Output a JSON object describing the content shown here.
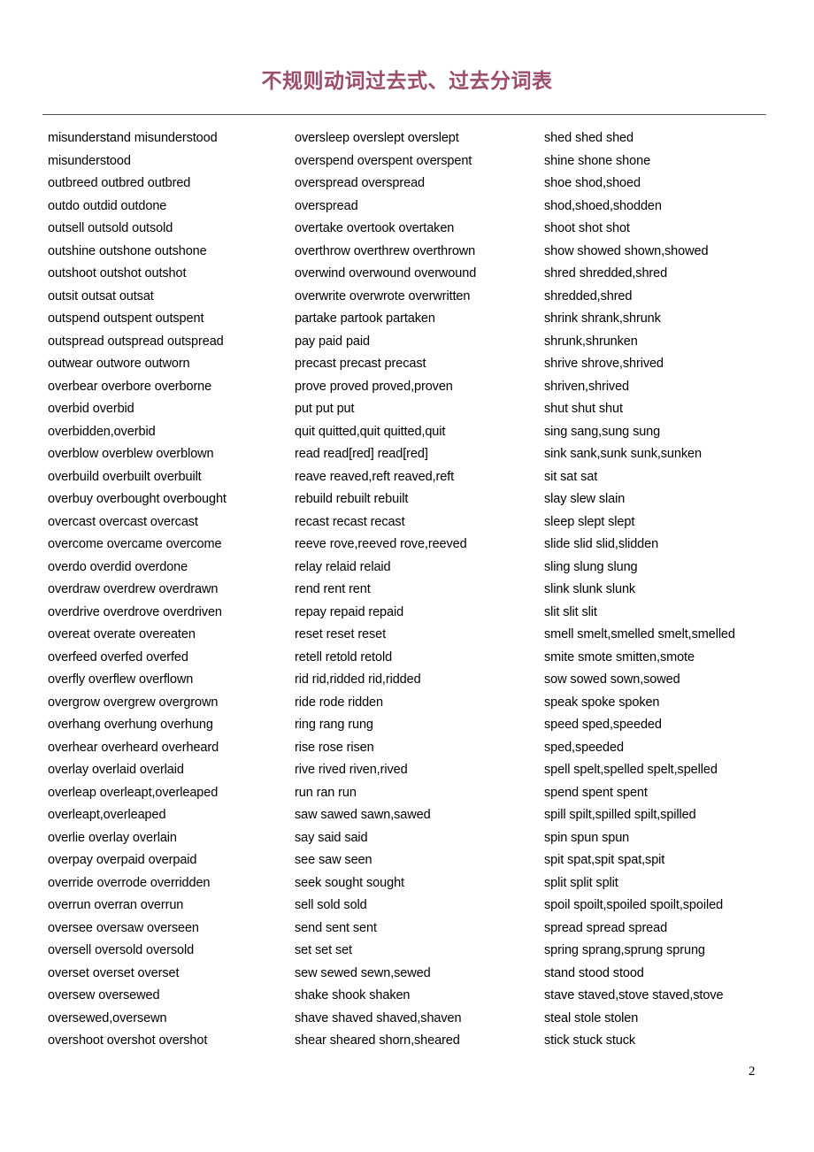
{
  "document": {
    "title": "不规则动词过去式、过去分词表",
    "title_color": "#9d4c6c",
    "rule_color": "#595059",
    "page_number": "2"
  },
  "columns": [
    {
      "id": "column-1",
      "lines": [
        "misunderstand misunderstood",
        "misunderstood",
        "outbreed outbred outbred",
        "outdo outdid outdone",
        "outsell outsold outsold",
        "outshine outshone outshone",
        "outshoot outshot outshot",
        "outsit outsat outsat",
        "outspend outspent outspent",
        "outspread outspread outspread",
        "outwear outwore outworn",
        "overbear overbore overborne",
        "overbid overbid",
        "overbidden,overbid",
        "overblow overblew overblown",
        "overbuild overbuilt overbuilt",
        "overbuy overbought overbought",
        "overcast overcast overcast",
        "overcome overcame overcome",
        "overdo overdid overdone",
        "overdraw overdrew overdrawn",
        "overdrive overdrove overdriven",
        "overeat overate overeaten",
        "overfeed overfed overfed",
        "overfly overflew overflown",
        "overgrow overgrew overgrown",
        "overhang overhung overhung",
        "overhear overheard overheard",
        "overlay overlaid overlaid",
        "overleap overleapt,overleaped",
        "overleapt,overleaped",
        "overlie overlay overlain",
        "overpay overpaid overpaid",
        "override overrode overridden",
        "overrun overran overrun",
        "oversee oversaw overseen",
        "oversell oversold oversold",
        "overset overset overset",
        "oversew oversewed",
        "oversewed,oversewn",
        "overshoot overshot overshot"
      ]
    },
    {
      "id": "column-2",
      "lines": [
        "oversleep overslept overslept",
        "overspend overspent overspent",
        "overspread overspread",
        "overspread",
        "overtake overtook overtaken",
        "overthrow overthrew overthrown",
        "overwind overwound overwound",
        "overwrite overwrote overwritten",
        "partake partook partaken",
        "pay paid paid",
        "precast precast precast",
        "prove proved proved,proven",
        "put put put",
        "quit quitted,quit quitted,quit",
        "read read[red] read[red]",
        "reave reaved,reft reaved,reft",
        "rebuild rebuilt rebuilt",
        "recast recast recast",
        "reeve rove,reeved rove,reeved",
        "relay relaid relaid",
        "rend rent rent",
        "repay repaid repaid",
        "reset reset reset",
        "retell retold retold",
        "rid rid,ridded rid,ridded",
        "ride rode ridden",
        "ring rang rung",
        "rise rose risen",
        "rive rived riven,rived",
        "run ran run",
        "saw sawed sawn,sawed",
        "say said said",
        "see saw seen",
        "seek sought sought",
        "sell sold sold",
        "send sent sent",
        "set set set",
        "sew sewed sewn,sewed",
        "shake shook shaken",
        "shave shaved shaved,shaven",
        "shear sheared shorn,sheared"
      ]
    },
    {
      "id": "column-3",
      "lines": [
        "shed shed shed",
        "shine shone shone",
        "shoe shod,shoed",
        "shod,shoed,shodden",
        "shoot shot shot",
        "show showed shown,showed",
        "shred shredded,shred",
        "shredded,shred",
        "shrink shrank,shrunk",
        "shrunk,shrunken",
        "shrive shrove,shrived",
        "shriven,shrived",
        "shut shut shut",
        "sing sang,sung sung",
        "sink sank,sunk sunk,sunken",
        "sit sat sat",
        "slay slew slain",
        "sleep slept slept",
        "slide slid slid,slidden",
        "sling slung slung",
        "slink slunk slunk",
        "slit slit slit",
        "smell smelt,smelled smelt,smelled",
        "smite smote smitten,smote",
        "sow sowed sown,sowed",
        "speak spoke spoken",
        "speed sped,speeded",
        "sped,speeded",
        "spell spelt,spelled spelt,spelled",
        "spend spent spent",
        "spill spilt,spilled spilt,spilled",
        "spin spun spun",
        "spit spat,spit spat,spit",
        "split split split",
        "spoil spoilt,spoiled spoilt,spoiled",
        "spread spread spread",
        "spring sprang,sprung sprung",
        "stand stood stood",
        "stave staved,stove staved,stove",
        "steal stole stolen",
        "stick stuck stuck"
      ]
    }
  ]
}
